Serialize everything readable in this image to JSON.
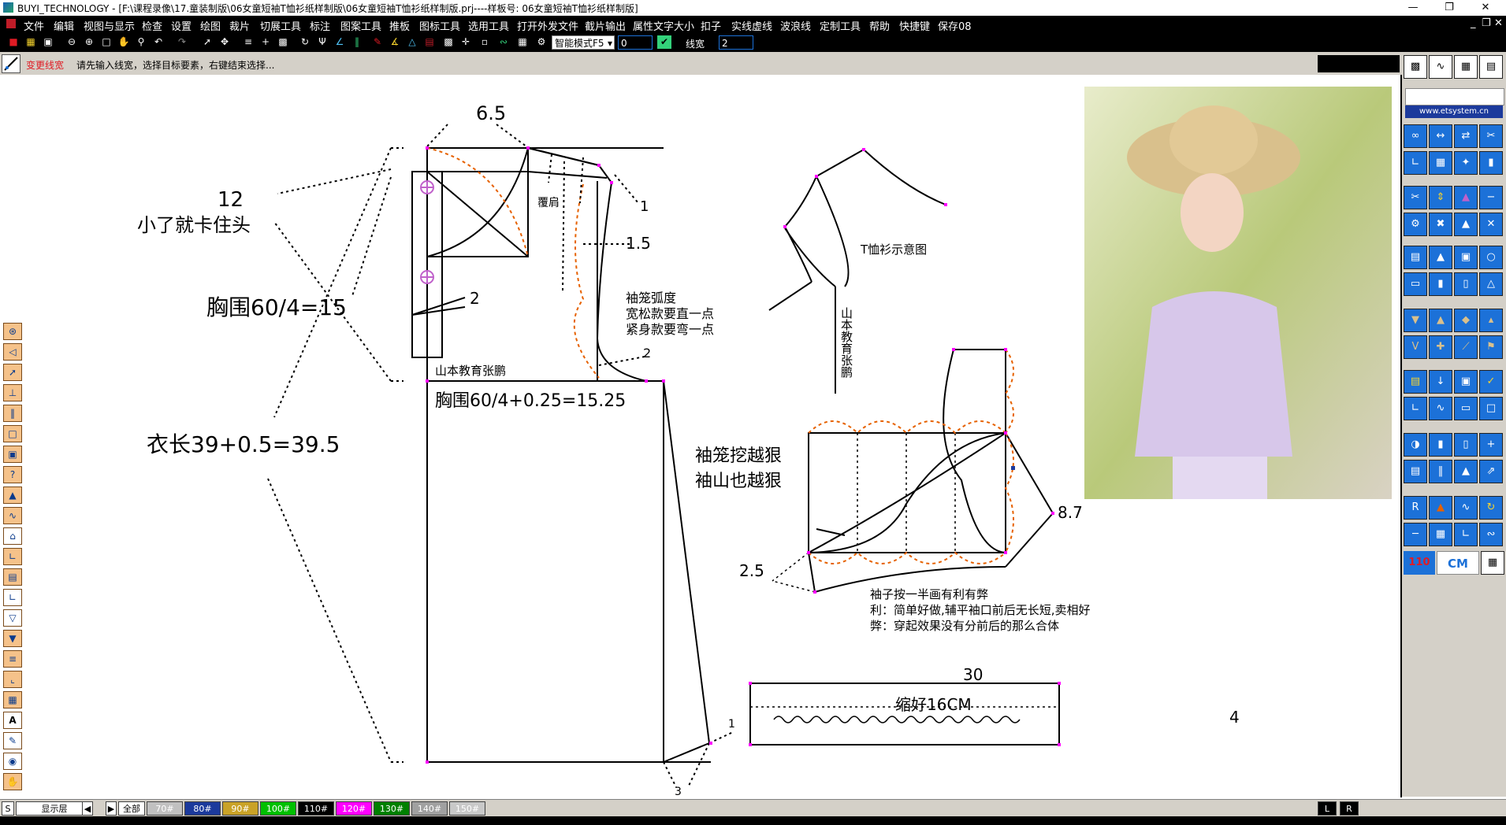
{
  "window": {
    "title": "BUYI_TECHNOLOGY - [F:\\课程录像\\17.童装制版\\06女童短袖T恤衫纸样制版\\06女童短袖T恤衫纸样制版.prj----样板号: 06女童短袖T恤衫纸样制版]"
  },
  "menu": [
    "文件",
    "编辑",
    "视图与显示",
    "检查",
    "设置",
    "绘图",
    "裁片",
    "切展工具",
    "标注",
    "图案工具",
    "推板",
    "图标工具",
    "选用工具",
    "打开外发文件",
    "截片输出",
    "属性文字大小",
    "扣子",
    "实线虚线",
    "波浪线",
    "定制工具",
    "帮助",
    "快捷键",
    "保存08"
  ],
  "toolbar": {
    "mode_select": "智能模式F5",
    "value_field": "0",
    "line_width_label": "线宽",
    "line_width_value": "2"
  },
  "prompt": {
    "title": "变更线宽",
    "message": "请先输入线宽，选择目标要素，右键结束选择..."
  },
  "drawing": {
    "labels": {
      "shoulder_top": "6.5",
      "collar_num": "12",
      "note_collar": "小了就卡住头",
      "chest_upper": "胸围60/4=15",
      "length": "衣长39+0.5=39.5",
      "chest_main": "胸围60/4+0.25=15.25",
      "cover_shoulder": "覆肩",
      "num_1_top": "1",
      "num_1_5": "1.5",
      "num_2_left": "2",
      "num_2_arm": "2",
      "sleeve_curve_note_1": "袖笼弧度",
      "sleeve_curve_note_2": "宽松款要直一点",
      "sleeve_curve_note_3": "紧身款要弯一点",
      "author_1": "山本教育张鹏",
      "tshirt_diagram": "T恤衫示意图",
      "author_2": "山本教育张鹏",
      "sleeve_note_1": "袖笼挖越狠",
      "sleeve_note_2": "袖山也越狠",
      "num_8_7": "8.7",
      "num_2_5": "2.5",
      "sleeve_desc_1": "袖子按一半画有利有弊",
      "sleeve_desc_2": "利：简单好做,辅平袖口前后无长短,卖相好",
      "sleeve_desc_3": "弊：穿起效果没有分前后的那么合体",
      "band_width": "30",
      "band_label": "缩好16CM",
      "band_height": "4",
      "num_1_hem": "1",
      "num_3_hem": "3"
    }
  },
  "right_panel": {
    "url": "www.etsystem.cn",
    "size_btn": "110",
    "unit_btn": "CM"
  },
  "bottom": {
    "s_label": "S",
    "layer_select": "显示层",
    "all_label": "全部",
    "sizes": [
      "70#",
      "80#",
      "90#",
      "100#",
      "110#",
      "120#",
      "130#",
      "140#",
      "150#"
    ],
    "size_colors": [
      "#c0c0c0",
      "#1c3a9c",
      "#c9a227",
      "#00c000",
      "#000000",
      "#ff00ff",
      "#008000",
      "#a0a0a0",
      "#c8c8c8"
    ],
    "l_label": "L",
    "r_label": "R"
  }
}
